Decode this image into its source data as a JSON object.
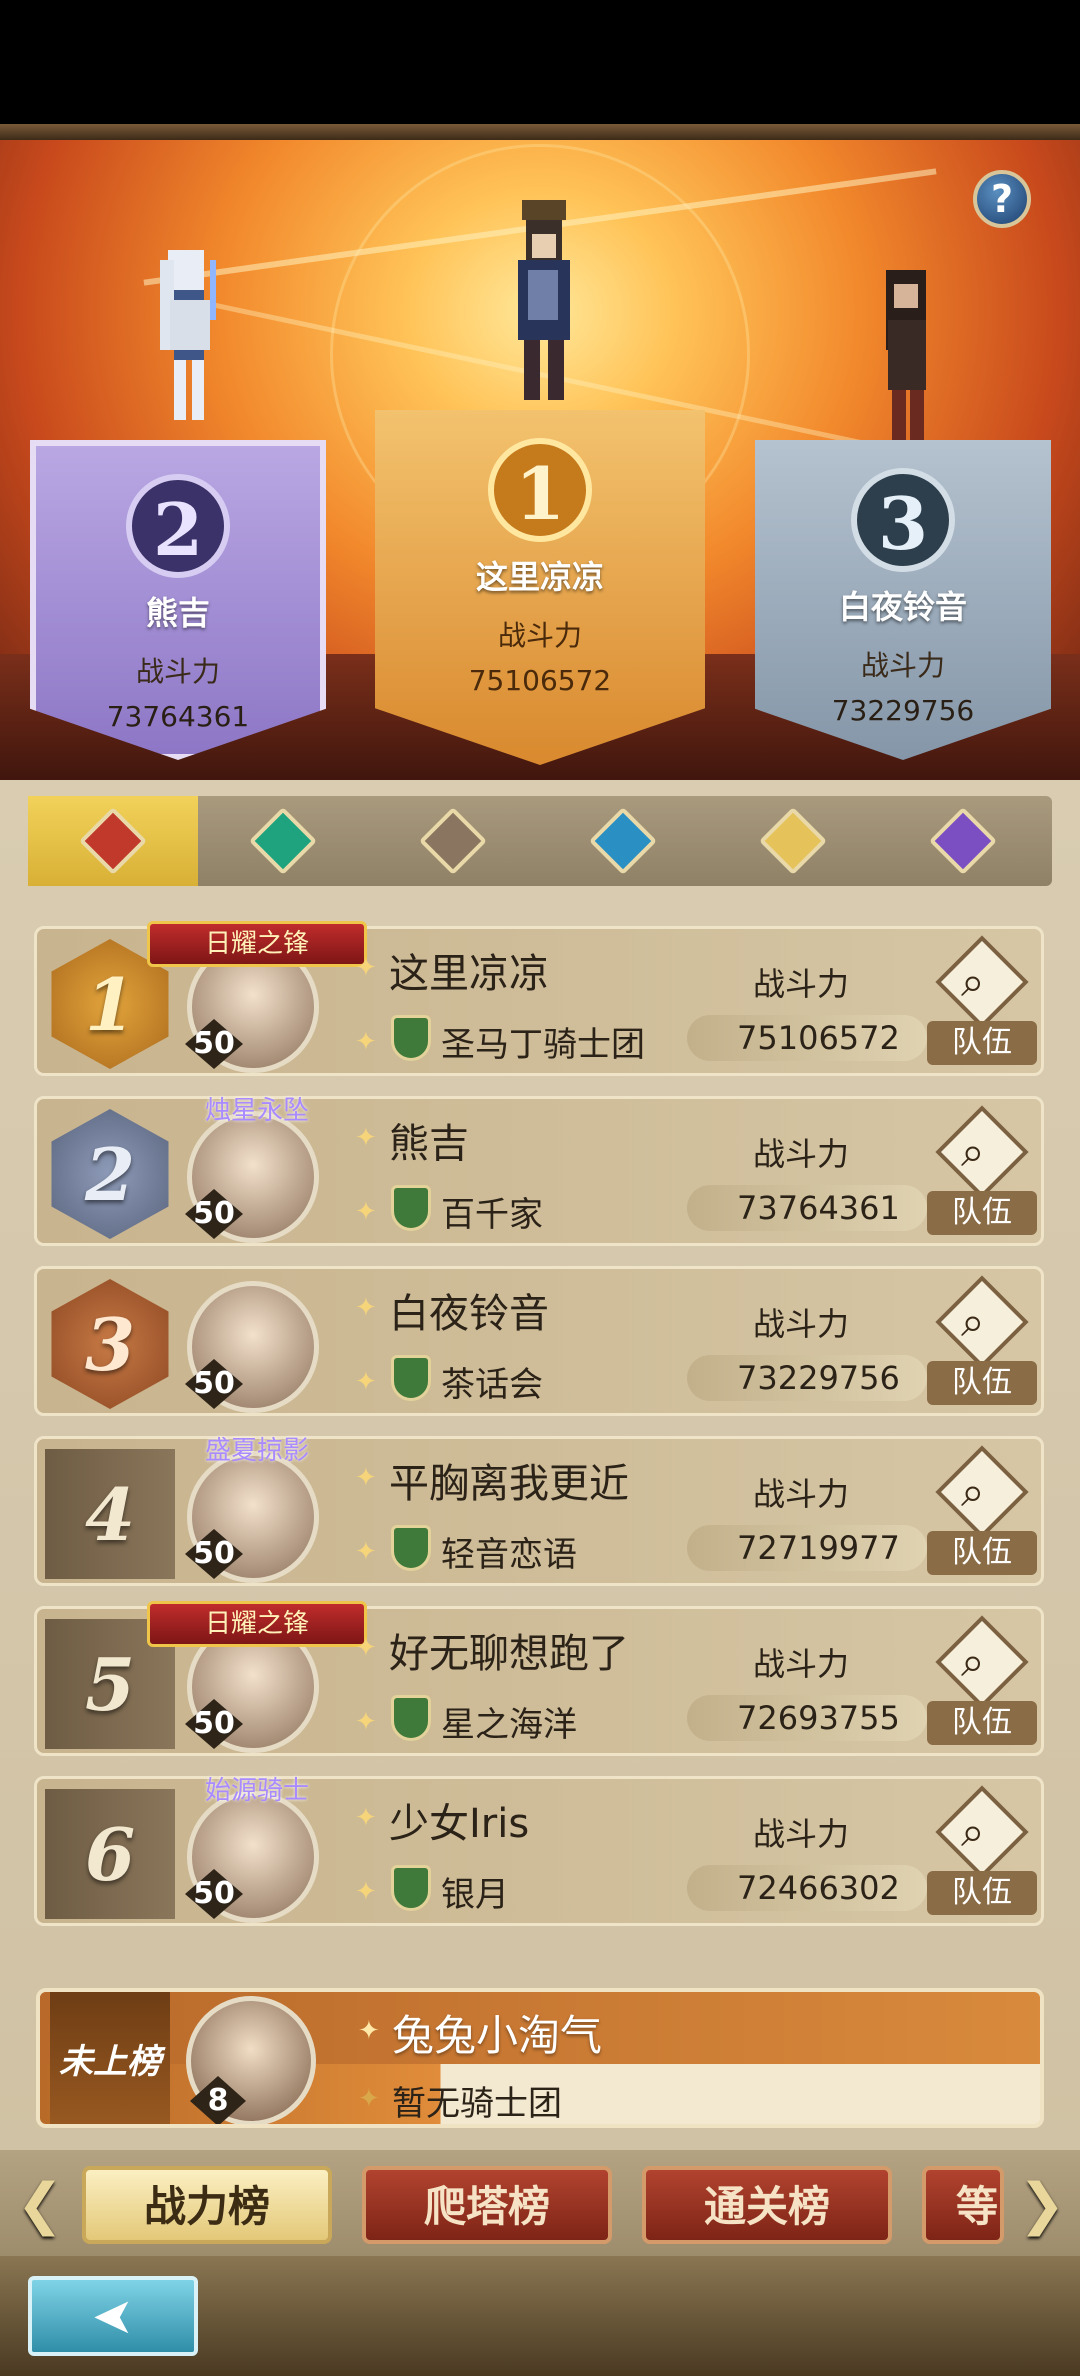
{
  "help": {
    "label": "?"
  },
  "podium": [
    {
      "rank": "2",
      "name": "熊吉",
      "label": "战斗力",
      "power": "73764361"
    },
    {
      "rank": "1",
      "name": "这里凉凉",
      "label": "战斗力",
      "power": "75106572"
    },
    {
      "rank": "3",
      "name": "白夜铃音",
      "label": "战斗力",
      "power": "73229756"
    }
  ],
  "element_tabs": [
    {
      "name": "fire",
      "color": "#c0392b"
    },
    {
      "name": "wind",
      "color": "#1fa37f"
    },
    {
      "name": "earth",
      "color": "#8a7660"
    },
    {
      "name": "water",
      "color": "#2a8fc2"
    },
    {
      "name": "light",
      "color": "#e6c25a"
    },
    {
      "name": "dark",
      "color": "#7b4fc2"
    }
  ],
  "rows": [
    {
      "rank": "1",
      "title": "日耀之锋",
      "level": "50",
      "name": "这里凉凉",
      "guild": "圣马丁骑士团",
      "label": "战斗力",
      "power": "75106572",
      "team": "队伍"
    },
    {
      "rank": "2",
      "title": "烛星永坠",
      "level": "50",
      "name": "熊吉",
      "guild": "百千家",
      "label": "战斗力",
      "power": "73764361",
      "team": "队伍"
    },
    {
      "rank": "3",
      "title": "",
      "level": "50",
      "name": "白夜铃音",
      "guild": "茶话会",
      "label": "战斗力",
      "power": "73229756",
      "team": "队伍"
    },
    {
      "rank": "4",
      "title": "盛夏掠影",
      "level": "50",
      "name": "平胸离我更近",
      "guild": "轻音恋语",
      "label": "战斗力",
      "power": "72719977",
      "team": "队伍"
    },
    {
      "rank": "5",
      "title": "日耀之锋",
      "level": "50",
      "name": "好无聊想跑了",
      "guild": "星之海洋",
      "label": "战斗力",
      "power": "72693755",
      "team": "队伍"
    },
    {
      "rank": "6",
      "title": "始源骑士",
      "level": "50",
      "name": "少女Iris",
      "guild": "银月",
      "label": "战斗力",
      "power": "72466302",
      "team": "队伍"
    }
  ],
  "me": {
    "rank": "未上榜",
    "level": "8",
    "name": "兔兔小淘气",
    "guild": "暂无骑士团"
  },
  "bottom_tabs": [
    "战力榜",
    "爬塔榜",
    "通关榜",
    "等"
  ],
  "arrows": {
    "left": "❮",
    "right": "❯"
  },
  "back": {
    "icon": "back-arrow-icon"
  }
}
